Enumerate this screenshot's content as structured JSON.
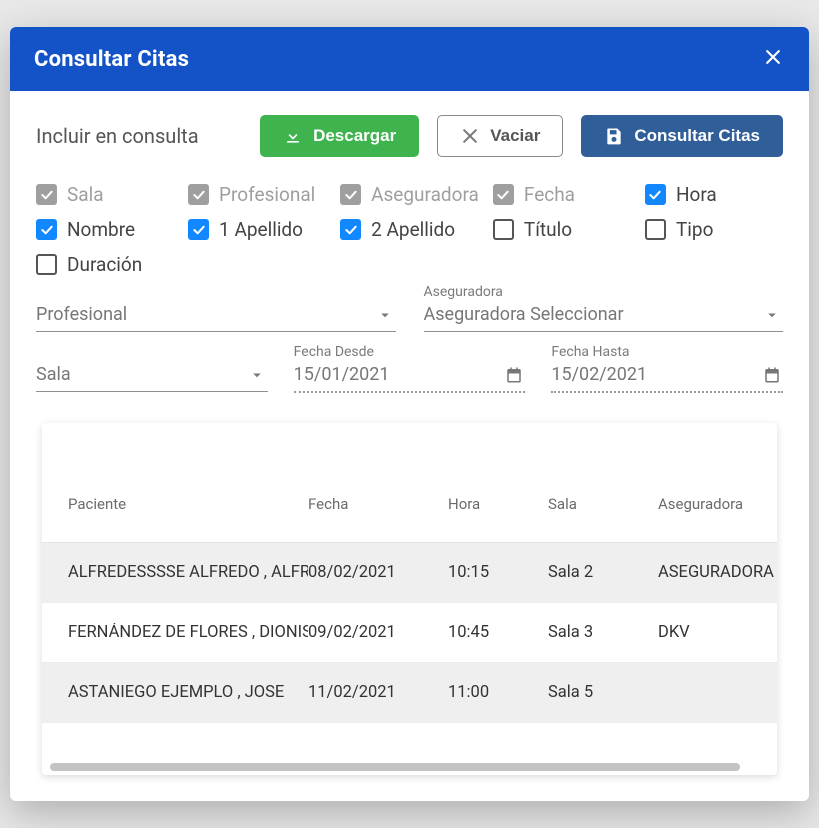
{
  "title": "Consultar Citas",
  "toolbar": {
    "include_label": "Incluir en consulta",
    "download_label": "Descargar",
    "clear_label": "Vaciar",
    "query_label": "Consultar Citas"
  },
  "checks": {
    "sala": "Sala",
    "profesional": "Profesional",
    "aseguradora": "Aseguradora",
    "fecha": "Fecha",
    "hora": "Hora",
    "nombre": "Nombre",
    "apellido1": "1 Apellido",
    "apellido2": "2 Apellido",
    "titulo": "Título",
    "tipo": "Tipo",
    "duracion": "Duración"
  },
  "filters": {
    "profesional_placeholder": "Profesional",
    "aseguradora_float": "Aseguradora",
    "aseguradora_placeholder": "Aseguradora Seleccionar",
    "sala_placeholder": "Sala",
    "fecha_desde_float": "Fecha Desde",
    "fecha_desde_value": "15/01/2021",
    "fecha_hasta_float": "Fecha Hasta",
    "fecha_hasta_value": "15/02/2021"
  },
  "table": {
    "headers": {
      "paciente": "Paciente",
      "fecha": "Fecha",
      "hora": "Hora",
      "sala": "Sala",
      "aseguradora": "Aseguradora"
    },
    "rows": [
      {
        "paciente": "ALFREDESSSSE ALFREDO , ALFREDO",
        "fecha": "08/02/2021",
        "hora": "10:15",
        "sala": "Sala 2",
        "aseguradora": "ASEGURADORA GENERAL"
      },
      {
        "paciente": "FERNÁNDEZ DE FLORES , DIONISIO",
        "fecha": "09/02/2021",
        "hora": "10:45",
        "sala": "Sala 3",
        "aseguradora": "DKV"
      },
      {
        "paciente": "ASTANIEGO EJEMPLO , JOSE",
        "fecha": "11/02/2021",
        "hora": "11:00",
        "sala": "Sala 5",
        "aseguradora": ""
      }
    ]
  }
}
